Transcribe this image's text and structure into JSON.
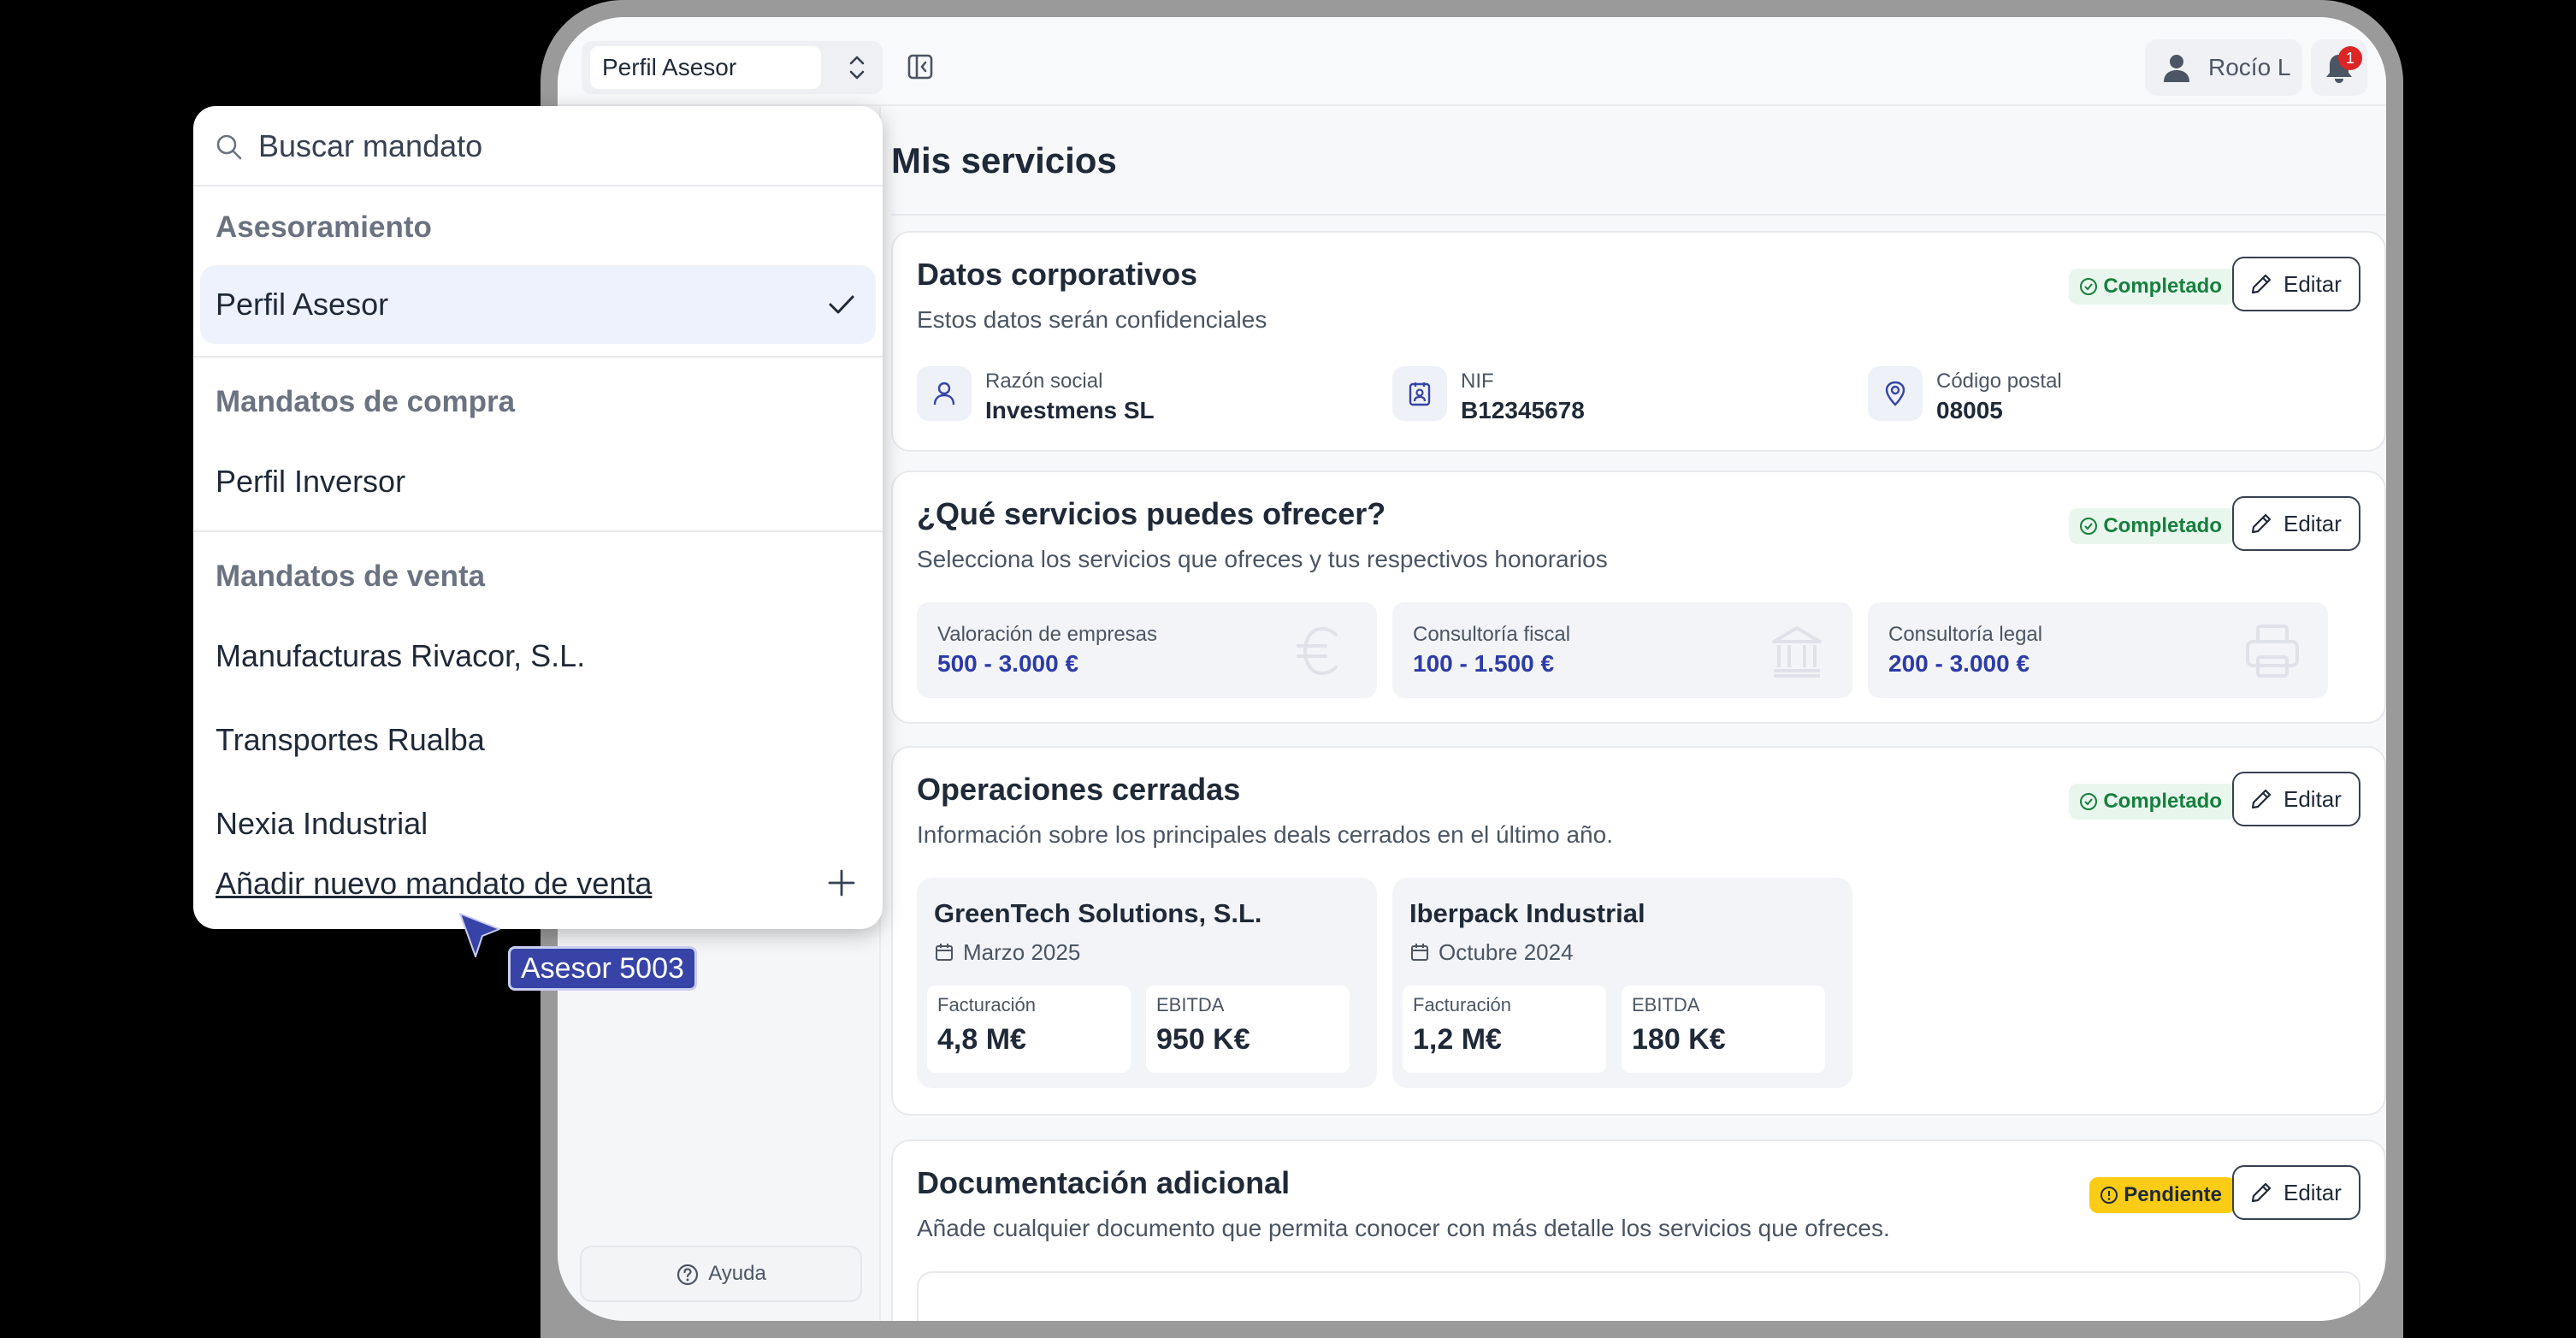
{
  "colors": {
    "background": "#000000",
    "accent": "#3743a6",
    "service_value": "#2d3ba8",
    "status_done_bg": "#e9f6ee",
    "status_done_text": "#15803d",
    "status_pending_bg": "#facc15",
    "badge": "#dc2626"
  },
  "topbar": {
    "profile_select": "Perfil Asesor",
    "user_name": "Rocío L",
    "notifications_count": "1"
  },
  "sidebar": {
    "help_label": "Ayuda"
  },
  "main": {
    "title": "Mis servicios",
    "cards": {
      "corporate": {
        "title": "Datos corporativos",
        "subtitle": "Estos datos serán confidenciales",
        "status": "Completado",
        "edit_label": "Editar",
        "fields": [
          {
            "label": "Razón social",
            "value": "Investmens SL",
            "icon": "user-icon"
          },
          {
            "label": "NIF",
            "value": "B12345678",
            "icon": "id-card-icon"
          },
          {
            "label": "Código postal",
            "value": "08005",
            "icon": "map-pin-icon"
          }
        ]
      },
      "services": {
        "title": "¿Qué servicios puedes ofrecer?",
        "subtitle": "Selecciona los servicios que ofreces y tus respectivos honorarios",
        "status": "Completado",
        "edit_label": "Editar",
        "items": [
          {
            "label": "Valoración de empresas",
            "value": "500 - 3.000 €",
            "icon": "euro-icon"
          },
          {
            "label": "Consultoría fiscal",
            "value": "100 - 1.500 €",
            "icon": "bank-icon"
          },
          {
            "label": "Consultoría legal",
            "value": "200 - 3.000 €",
            "icon": "printer-icon"
          }
        ]
      },
      "deals": {
        "title": "Operaciones cerradas",
        "subtitle": "Información sobre los principales deals cerrados en el último año.",
        "status": "Completado",
        "edit_label": "Editar",
        "items": [
          {
            "name": "GreenTech Solutions, S.L.",
            "date": "Marzo 2025",
            "metrics": [
              {
                "label": "Facturación",
                "value": "4,8 M€"
              },
              {
                "label": "EBITDA",
                "value": "950 K€"
              }
            ]
          },
          {
            "name": "Iberpack Industrial",
            "date": "Octubre 2024",
            "metrics": [
              {
                "label": "Facturación",
                "value": "1,2 M€"
              },
              {
                "label": "EBITDA",
                "value": "180 K€"
              }
            ]
          }
        ]
      },
      "docs": {
        "title": "Documentación adicional",
        "subtitle": "Añade cualquier documento que permita conocer con más detalle los servicios que ofreces.",
        "status": "Pendiente",
        "edit_label": "Editar"
      }
    }
  },
  "dropdown": {
    "search_placeholder": "Buscar mandato",
    "groups": [
      {
        "label": "Asesoramiento",
        "items": [
          "Perfil Asesor"
        ]
      },
      {
        "label": "Mandatos de compra",
        "items": [
          "Perfil Inversor"
        ]
      },
      {
        "label": "Mandatos de venta",
        "items": [
          "Manufacturas Rivacor, S.L.",
          "Transportes Rualba",
          "Nexia Industrial"
        ]
      }
    ],
    "selected": "Perfil Asesor",
    "add_label": "Añadir nuevo mandato de venta"
  },
  "cursor_label": "Asesor 5003"
}
